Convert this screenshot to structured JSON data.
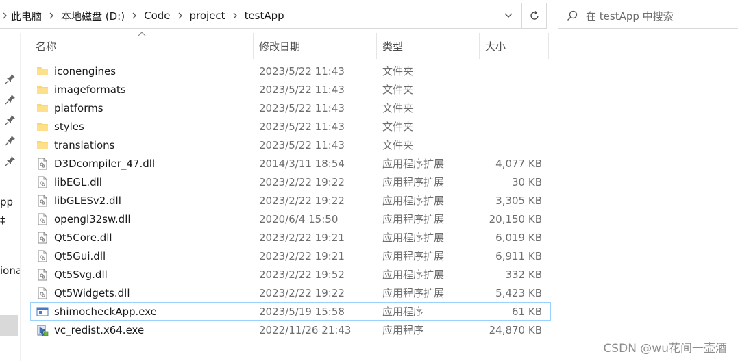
{
  "address_bar": {
    "crumbs": [
      "此电脑",
      "本地磁盘 (D:)",
      "Code",
      "project",
      "testApp"
    ]
  },
  "search": {
    "placeholder": "在 testApp 中搜索"
  },
  "nav_pane": {
    "fragments": [
      "ᵒ",
      "pp",
      "‡",
      "iona"
    ]
  },
  "columns": {
    "name": "名称",
    "date": "修改日期",
    "type": "类型",
    "size": "大小"
  },
  "files": [
    {
      "name": "iconengines",
      "date": "2023/5/22 11:43",
      "type": "文件夹",
      "size": "",
      "icon": "folder-icon"
    },
    {
      "name": "imageformats",
      "date": "2023/5/22 11:43",
      "type": "文件夹",
      "size": "",
      "icon": "folder-icon"
    },
    {
      "name": "platforms",
      "date": "2023/5/22 11:43",
      "type": "文件夹",
      "size": "",
      "icon": "folder-icon"
    },
    {
      "name": "styles",
      "date": "2023/5/22 11:43",
      "type": "文件夹",
      "size": "",
      "icon": "folder-icon"
    },
    {
      "name": "translations",
      "date": "2023/5/22 11:43",
      "type": "文件夹",
      "size": "",
      "icon": "folder-icon"
    },
    {
      "name": "D3Dcompiler_47.dll",
      "date": "2014/3/11 18:54",
      "type": "应用程序扩展",
      "size": "4,077 KB",
      "icon": "dll-file-icon"
    },
    {
      "name": "libEGL.dll",
      "date": "2023/2/22 19:22",
      "type": "应用程序扩展",
      "size": "30 KB",
      "icon": "dll-file-icon"
    },
    {
      "name": "libGLESv2.dll",
      "date": "2023/2/22 19:22",
      "type": "应用程序扩展",
      "size": "3,305 KB",
      "icon": "dll-file-icon"
    },
    {
      "name": "opengl32sw.dll",
      "date": "2020/6/4 15:50",
      "type": "应用程序扩展",
      "size": "20,150 KB",
      "icon": "dll-file-icon"
    },
    {
      "name": "Qt5Core.dll",
      "date": "2023/2/22 19:21",
      "type": "应用程序扩展",
      "size": "6,019 KB",
      "icon": "dll-file-icon"
    },
    {
      "name": "Qt5Gui.dll",
      "date": "2023/2/22 19:21",
      "type": "应用程序扩展",
      "size": "6,911 KB",
      "icon": "dll-file-icon"
    },
    {
      "name": "Qt5Svg.dll",
      "date": "2023/2/22 19:52",
      "type": "应用程序扩展",
      "size": "332 KB",
      "icon": "dll-file-icon"
    },
    {
      "name": "Qt5Widgets.dll",
      "date": "2023/2/22 19:22",
      "type": "应用程序扩展",
      "size": "5,423 KB",
      "icon": "dll-file-icon"
    },
    {
      "name": "shimocheckApp.exe",
      "date": "2023/5/19 15:58",
      "type": "应用程序",
      "size": "61 KB",
      "icon": "exe-app-icon",
      "selected": true
    },
    {
      "name": "vc_redist.x64.exe",
      "date": "2022/11/26 21:43",
      "type": "应用程序",
      "size": "24,870 KB",
      "icon": "installer-icon"
    }
  ],
  "watermark": "CSDN @wu花间一壶酒",
  "colors": {
    "folder": "#f8d775",
    "selection_outline": "#99d1ff",
    "nav_selected": "#d9d9d9"
  }
}
